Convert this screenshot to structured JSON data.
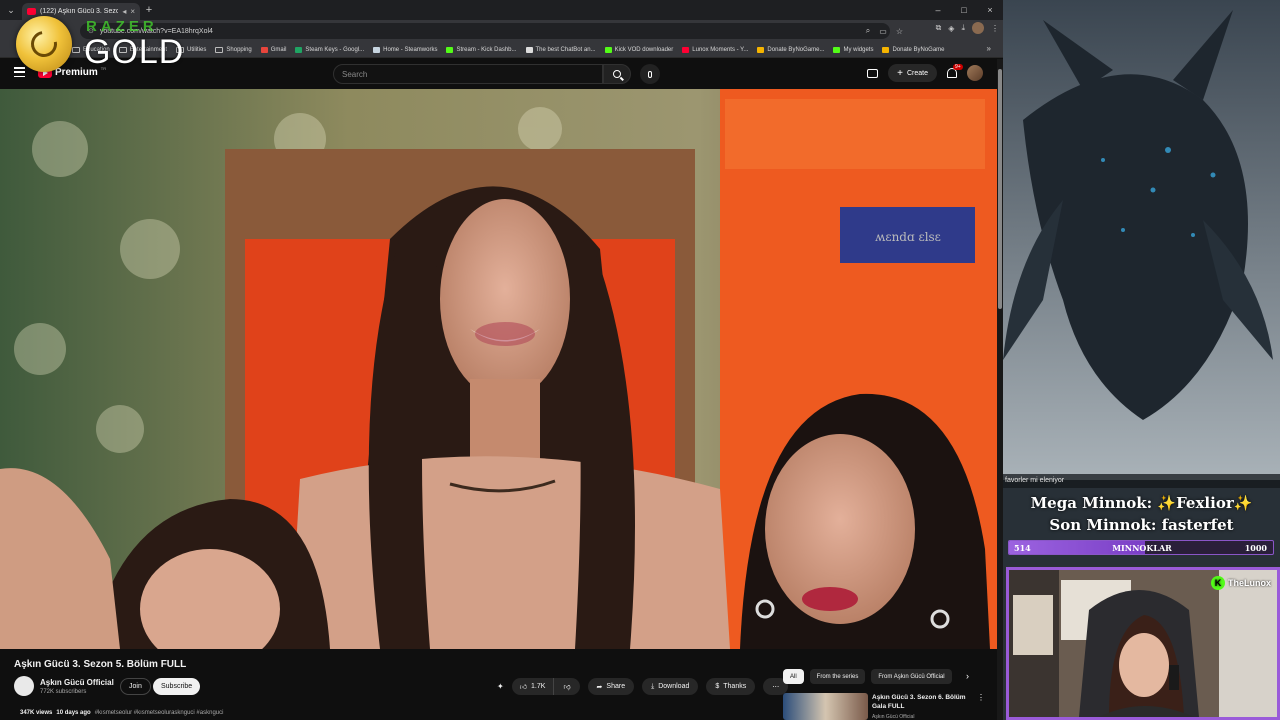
{
  "browser": {
    "tab_title": "(122) Aşkın Gücü 3. Sezon",
    "url": "youtube.com/watch?v=EA18hrqXol4",
    "bookmarks": [
      {
        "label": "Education",
        "type": "folder"
      },
      {
        "label": "Entertainment",
        "type": "folder"
      },
      {
        "label": "Utilities",
        "type": "folder"
      },
      {
        "label": "Shopping",
        "type": "folder"
      },
      {
        "label": "Gmail",
        "type": "site",
        "color": "#e8453c"
      },
      {
        "label": "Steam Keys - Googl...",
        "type": "site",
        "color": "#1fa463"
      },
      {
        "label": "Home - Steamworks",
        "type": "site",
        "color": "#c7d5e0"
      },
      {
        "label": "Stream - Kick Dashb...",
        "type": "site",
        "color": "#53fc18"
      },
      {
        "label": "The best ChatBot an...",
        "type": "site",
        "color": "#dddddd"
      },
      {
        "label": "Kick VOD downloader",
        "type": "site",
        "color": "#53fc18"
      },
      {
        "label": "Lunox Moments - Y...",
        "type": "site",
        "color": "#ff0033"
      },
      {
        "label": "Donate ByNoGame...",
        "type": "site",
        "color": "#f5b400"
      },
      {
        "label": "My widgets",
        "type": "site",
        "color": "#53fc18"
      },
      {
        "label": "Donate ByNoGame",
        "type": "site",
        "color": "#f5b400"
      }
    ]
  },
  "razer": {
    "brand": "RAZER",
    "tier": "GOLD"
  },
  "youtube": {
    "logo_text": "Premium",
    "logo_region": "TR",
    "search_placeholder": "Search",
    "create_label": "Create",
    "notification_count": "9+",
    "video_title": "Aşkın Gücü 3. Sezon 5. Bölüm FULL",
    "channel_name": "Aşkın Gücü Official",
    "channel_subs": "772K subscribers",
    "join_label": "Join",
    "subscribe_label": "Subscribe",
    "like_count": "1.7K",
    "share_label": "Share",
    "download_label": "Download",
    "thanks_label": "Thanks",
    "views": "347K views",
    "uploaded": "10 days ago",
    "tags": "#kısmetseolur #kısmetseolurasknguci #asknguci",
    "chips": [
      "All",
      "From the series",
      "From Aşkın Gücü Official"
    ],
    "related_title": "Aşkın Gücü 3. Sezon 6. Bölüm Gala FULL",
    "related_channel": "Aşkın Gücü Official"
  },
  "stream_overlay": {
    "notification": "favorler mi eleniyor",
    "mega_minnok": "Mega Minnok: ✨Fexlior✨",
    "son_minnok": "Son Minnok: fasterfet",
    "bar_current": "514",
    "bar_label": "MINNOKLAR",
    "bar_goal": "1000",
    "bar_fraction": 0.514,
    "streamer_name": "TheLunox",
    "accent_color": "#9a5bd9"
  }
}
